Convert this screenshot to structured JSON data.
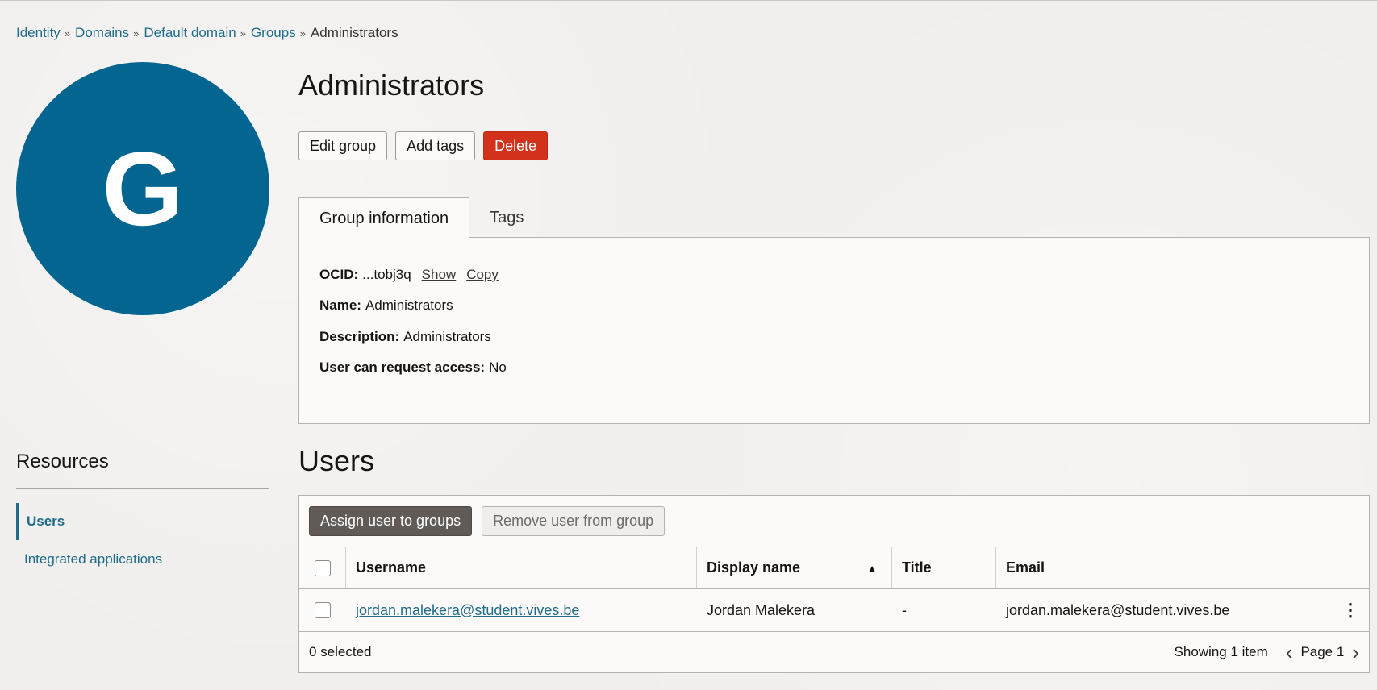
{
  "breadcrumb": {
    "items": [
      "Identity",
      "Domains",
      "Default domain",
      "Groups"
    ],
    "current": "Administrators",
    "separator": "»"
  },
  "avatar": {
    "letter": "G",
    "color": "#046690"
  },
  "page": {
    "title": "Administrators"
  },
  "actions": {
    "edit_label": "Edit group",
    "add_tags_label": "Add tags",
    "delete_label": "Delete"
  },
  "tabs": [
    {
      "label": "Group information",
      "active": true
    },
    {
      "label": "Tags",
      "active": false
    }
  ],
  "info": {
    "ocid_label": "OCID:",
    "ocid_value": "...tobj3q",
    "show_label": "Show",
    "copy_label": "Copy",
    "name_label": "Name:",
    "name_value": "Administrators",
    "description_label": "Description:",
    "description_value": "Administrators",
    "request_label": "User can request access:",
    "request_value": "No"
  },
  "resources": {
    "title": "Resources",
    "items": [
      {
        "label": "Users",
        "active": true
      },
      {
        "label": "Integrated applications",
        "active": false
      }
    ]
  },
  "users": {
    "title": "Users",
    "assign_label": "Assign user to groups",
    "remove_label": "Remove user from group",
    "columns": [
      "Username",
      "Display name",
      "Title",
      "Email"
    ],
    "rows": [
      {
        "username": "jordan.malekera@student.vives.be",
        "display_name": "Jordan Malekera",
        "title": "-",
        "email": "jordan.malekera@student.vives.be"
      }
    ],
    "selected_text": "0 selected",
    "showing_text": "Showing 1 item",
    "page_text": "Page 1"
  },
  "colors": {
    "accent": "#1f6b8a",
    "danger": "#d2321b",
    "avatar": "#046690"
  }
}
